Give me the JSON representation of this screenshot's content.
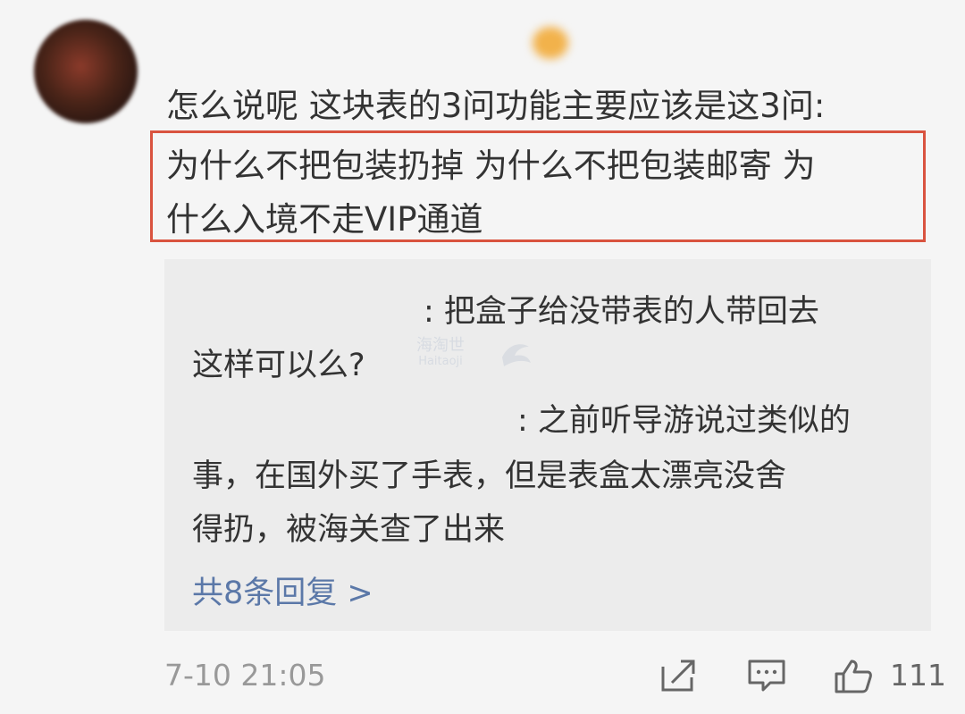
{
  "comment": {
    "lines": [
      "怎么说呢 这块表的3问功能主要应该是这3问:",
      "为什么不把包装扔掉 为什么不把包装邮寄 为",
      "什么入境不走VIP通道"
    ]
  },
  "replies": [
    {
      "text_lines": [
        ": 把盒子给没带表的人带回去",
        "这样可以么?"
      ]
    },
    {
      "text_lines": [
        ": 之前听导游说过类似的",
        "事，在国外买了手表，但是表盒太漂亮没舍",
        "得扔，被海关查了出来"
      ]
    }
  ],
  "more_replies": "共8条回复 >",
  "footer": {
    "time": "7-10 21:05",
    "like_count": "111"
  },
  "watermark": {
    "line1": "海淘世",
    "line2": "Haitaoji"
  },
  "colors": {
    "highlight_border": "#d9533f",
    "link": "#5b78a8",
    "reply_bg": "#ececec",
    "page_bg": "#f5f5f5"
  },
  "icons": [
    "share-icon",
    "comment-icon",
    "like-icon"
  ]
}
